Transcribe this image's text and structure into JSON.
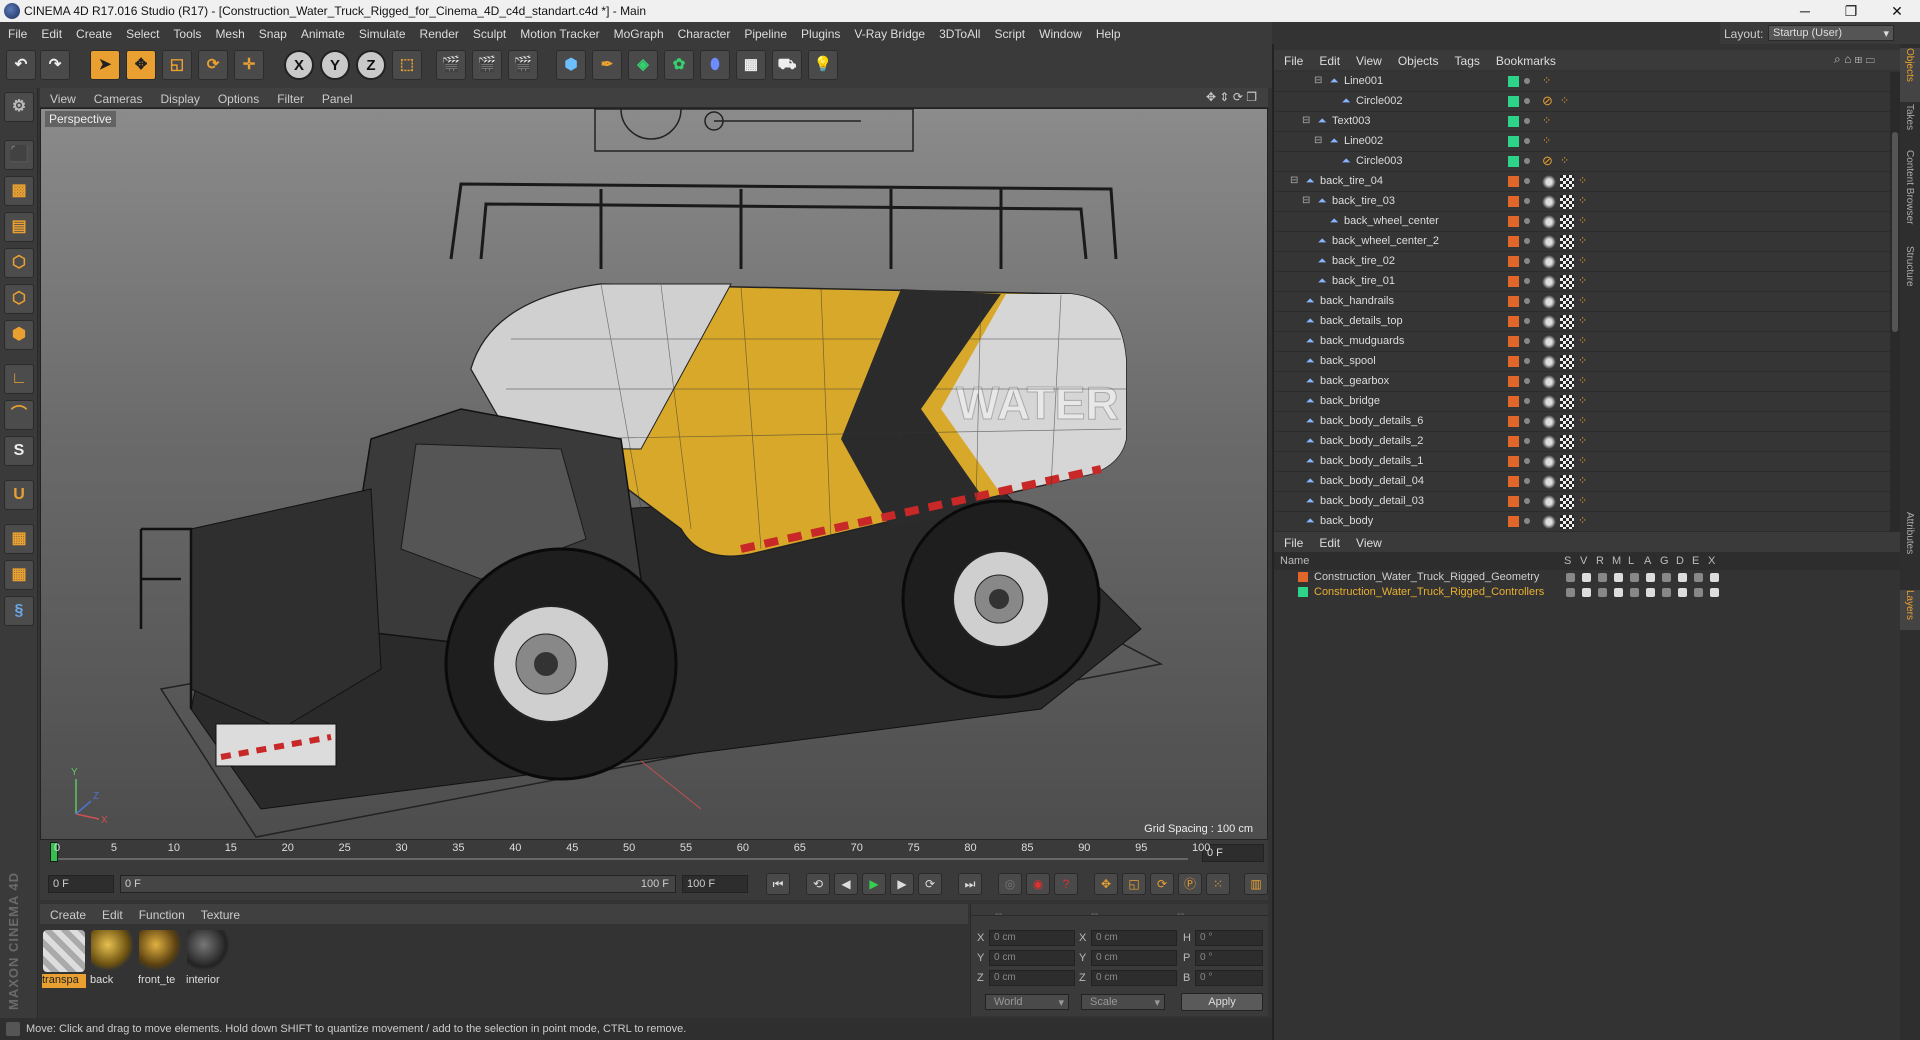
{
  "window": {
    "title": "CINEMA 4D R17.016 Studio (R17) - [Construction_Water_Truck_Rigged_for_Cinema_4D_c4d_standart.c4d *] - Main",
    "minimize": "─",
    "maximize": "❐",
    "close": "✕"
  },
  "menubar": [
    "File",
    "Edit",
    "Create",
    "Select",
    "Tools",
    "Mesh",
    "Snap",
    "Animate",
    "Simulate",
    "Render",
    "Sculpt",
    "Motion Tracker",
    "MoGraph",
    "Character",
    "Pipeline",
    "Plugins",
    "V-Ray Bridge",
    "3DToAll",
    "Script",
    "Window",
    "Help"
  ],
  "layout": {
    "label": "Layout:",
    "value": "Startup (User)"
  },
  "viewport": {
    "menu": [
      "View",
      "Cameras",
      "Display",
      "Options",
      "Filter",
      "Panel"
    ],
    "camera_label": "Perspective",
    "grid_spacing": "Grid Spacing : 100 cm",
    "tank_text": "WATER",
    "axis": {
      "x": "X",
      "y": "Y",
      "z": "Z"
    }
  },
  "timeline": {
    "ticks": [
      "0",
      "5",
      "10",
      "15",
      "20",
      "25",
      "30",
      "35",
      "40",
      "45",
      "50",
      "55",
      "60",
      "65",
      "70",
      "75",
      "80",
      "85",
      "90",
      "95",
      "100"
    ],
    "current_frame": "0 F"
  },
  "transport": {
    "start": "0 F",
    "range_start": "0 F",
    "range_end": "100 F",
    "end": "100 F"
  },
  "material_panel": {
    "menu": [
      "Create",
      "Edit",
      "Function",
      "Texture"
    ],
    "materials": [
      {
        "name": "transpa",
        "selected": true
      },
      {
        "name": "back",
        "selected": false
      },
      {
        "name": "front_te",
        "selected": false
      },
      {
        "name": "interior",
        "selected": false
      }
    ]
  },
  "coordinates": {
    "header": [
      "--",
      "--",
      "--"
    ],
    "rows": [
      {
        "a": "X",
        "av": "0 cm",
        "b": "X",
        "bv": "0 cm",
        "c": "H",
        "cv": "0 °"
      },
      {
        "a": "Y",
        "av": "0 cm",
        "b": "Y",
        "bv": "0 cm",
        "c": "P",
        "cv": "0 °"
      },
      {
        "a": "Z",
        "av": "0 cm",
        "b": "Z",
        "bv": "0 cm",
        "c": "B",
        "cv": "0 °"
      }
    ],
    "mode1": "World",
    "mode2": "Scale",
    "apply": "Apply"
  },
  "status": "Move: Click and drag to move elements. Hold down SHIFT to quantize movement / add to the selection in point mode, CTRL to remove.",
  "maxon_brand": "MAXON CINEMA 4D",
  "object_manager": {
    "menu": [
      "File",
      "Edit",
      "View",
      "Objects",
      "Tags",
      "Bookmarks"
    ],
    "objects": [
      {
        "name": "Line001",
        "depth": 3,
        "expand": "⊟",
        "color": "#2ed38a",
        "tags": "bone"
      },
      {
        "name": "Circle002",
        "depth": 4,
        "expand": "",
        "color": "#2ed38a",
        "tags": "circle"
      },
      {
        "name": "Text003",
        "depth": 2,
        "expand": "⊟",
        "color": "#2ed38a",
        "tags": "bone"
      },
      {
        "name": "Line002",
        "depth": 3,
        "expand": "⊟",
        "color": "#2ed38a",
        "tags": "bone"
      },
      {
        "name": "Circle003",
        "depth": 4,
        "expand": "",
        "color": "#2ed38a",
        "tags": "circle"
      },
      {
        "name": "back_tire_04",
        "depth": 1,
        "expand": "⊟",
        "color": "#e0662a",
        "tags": "mesh"
      },
      {
        "name": "back_tire_03",
        "depth": 2,
        "expand": "⊟",
        "color": "#e0662a",
        "tags": "mesh"
      },
      {
        "name": "back_wheel_center",
        "depth": 3,
        "expand": "",
        "color": "#e0662a",
        "tags": "mesh"
      },
      {
        "name": "back_wheel_center_2",
        "depth": 2,
        "expand": "",
        "color": "#e0662a",
        "tags": "mesh"
      },
      {
        "name": "back_tire_02",
        "depth": 2,
        "expand": "",
        "color": "#e0662a",
        "tags": "mesh"
      },
      {
        "name": "back_tire_01",
        "depth": 2,
        "expand": "",
        "color": "#e0662a",
        "tags": "mesh"
      },
      {
        "name": "back_handrails",
        "depth": 1,
        "expand": "",
        "color": "#e0662a",
        "tags": "mesh"
      },
      {
        "name": "back_details_top",
        "depth": 1,
        "expand": "",
        "color": "#e0662a",
        "tags": "mesh"
      },
      {
        "name": "back_mudguards",
        "depth": 1,
        "expand": "",
        "color": "#e0662a",
        "tags": "mesh"
      },
      {
        "name": "back_spool",
        "depth": 1,
        "expand": "",
        "color": "#e0662a",
        "tags": "mesh"
      },
      {
        "name": "back_gearbox",
        "depth": 1,
        "expand": "",
        "color": "#e0662a",
        "tags": "mesh"
      },
      {
        "name": "back_bridge",
        "depth": 1,
        "expand": "",
        "color": "#e0662a",
        "tags": "mesh"
      },
      {
        "name": "back_body_details_6",
        "depth": 1,
        "expand": "",
        "color": "#e0662a",
        "tags": "mesh"
      },
      {
        "name": "back_body_details_2",
        "depth": 1,
        "expand": "",
        "color": "#e0662a",
        "tags": "mesh"
      },
      {
        "name": "back_body_details_1",
        "depth": 1,
        "expand": "",
        "color": "#e0662a",
        "tags": "mesh"
      },
      {
        "name": "back_body_detail_04",
        "depth": 1,
        "expand": "",
        "color": "#e0662a",
        "tags": "mesh"
      },
      {
        "name": "back_body_detail_03",
        "depth": 1,
        "expand": "",
        "color": "#e0662a",
        "tags": "mesh"
      },
      {
        "name": "back_body",
        "depth": 1,
        "expand": "",
        "color": "#e0662a",
        "tags": "mesh"
      }
    ]
  },
  "layer_manager": {
    "menu": [
      "File",
      "Edit",
      "View"
    ],
    "columns": [
      "Name",
      "S",
      "V",
      "R",
      "M",
      "L",
      "A",
      "G",
      "D",
      "E",
      "X"
    ],
    "layers": [
      {
        "name": "Construction_Water_Truck_Rigged_Geometry",
        "color": "#e0662a",
        "text_color": "#cfcfcf"
      },
      {
        "name": "Construction_Water_Truck_Rigged_Controllers",
        "color": "#2ed38a",
        "text_color": "#e9b030"
      }
    ]
  },
  "side_tabs": [
    {
      "label": "Objects",
      "active": true
    },
    {
      "label": "Takes",
      "active": false
    },
    {
      "label": "Content Browser",
      "active": false
    },
    {
      "label": "Structure",
      "active": false
    },
    {
      "label": "Attributes",
      "active": false
    },
    {
      "label": "Layers",
      "active": true
    }
  ],
  "colors": {
    "accent": "#e9a030",
    "selection": "#e9b030",
    "green": "#2ed38a",
    "orange": "#e0662a"
  }
}
